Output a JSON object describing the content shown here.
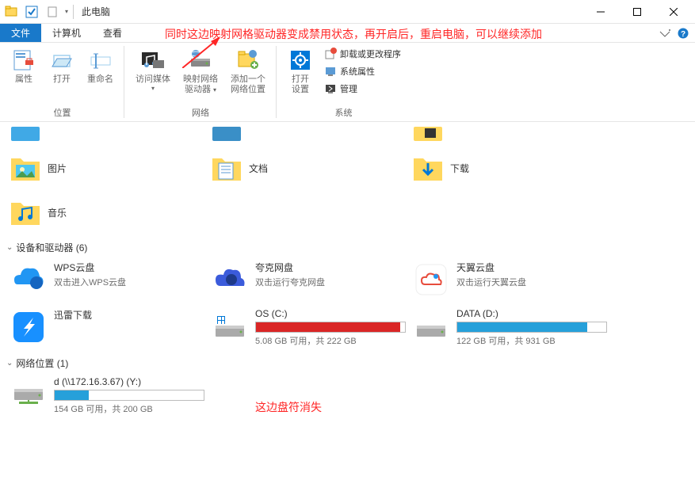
{
  "window": {
    "title": "此电脑"
  },
  "annotations": {
    "top": "同时这边映射网格驱动器变成禁用状态，再开启后，重启电脑，可以继续添加",
    "mid": "这边盘符消失"
  },
  "tabs": {
    "file": "文件",
    "computer": "计算机",
    "view": "查看"
  },
  "ribbon": {
    "location": {
      "label": "位置",
      "properties": "属性",
      "open": "打开",
      "rename": "重命名"
    },
    "network": {
      "label": "网络",
      "access_media": "访问媒体",
      "map_drive_l1": "映射网络",
      "map_drive_l2": "驱动器",
      "add_loc_l1": "添加一个",
      "add_loc_l2": "网络位置"
    },
    "system": {
      "label": "系统",
      "open_settings_l1": "打开",
      "open_settings_l2": "设置",
      "uninstall": "卸载或更改程序",
      "sys_props": "系统属性",
      "manage": "管理"
    }
  },
  "folders": {
    "pictures": "图片",
    "documents": "文档",
    "downloads": "下载",
    "music": "音乐"
  },
  "devices": {
    "header": "设备和驱动器 (6)",
    "wps": {
      "title": "WPS云盘",
      "sub": "双击进入WPS云盘"
    },
    "quark": {
      "title": "夸克网盘",
      "sub": "双击运行夸克网盘"
    },
    "tianyi": {
      "title": "天翼云盘",
      "sub": "双击运行天翼云盘"
    },
    "xunlei": {
      "title": "迅雷下载"
    },
    "os": {
      "title": "OS (C:)",
      "sub": "5.08 GB 可用，共 222 GB",
      "fill": "#da2626",
      "percent": 97
    },
    "data": {
      "title": "DATA (D:)",
      "sub": "122 GB 可用，共 931 GB",
      "fill": "#26a0da",
      "percent": 87
    }
  },
  "netloc": {
    "header": "网络位置 (1)",
    "drive": {
      "title": "d (\\\\172.16.3.67) (Y:)",
      "sub": "154 GB 可用，共 200 GB",
      "fill": "#26a0da",
      "percent": 23
    }
  }
}
